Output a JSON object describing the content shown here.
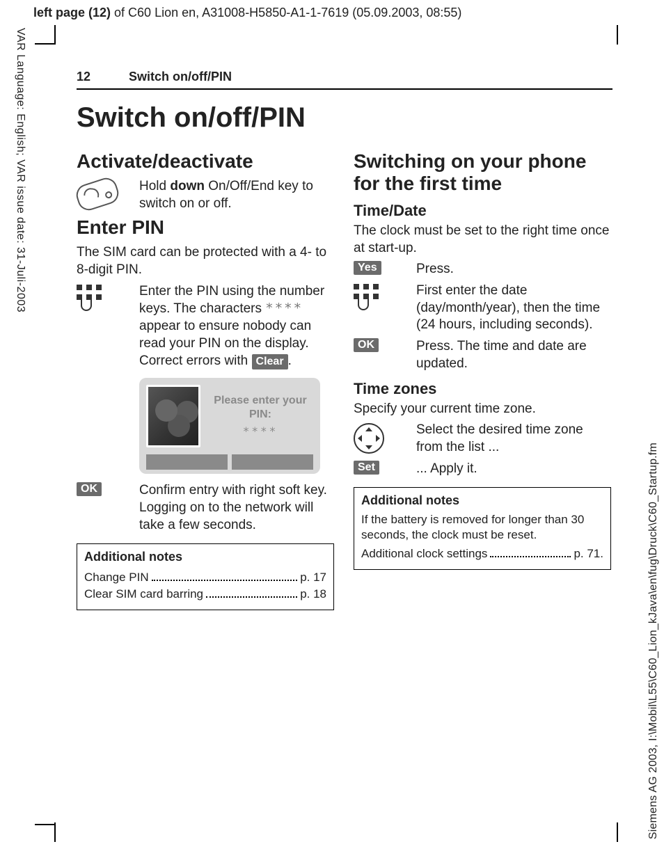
{
  "crop": {
    "top_bold": "left page (12)",
    "top_rest": " of C60 Lion en, A31008-H5850-A1-1-7619 (05.09.2003, 08:55)",
    "side_left": "VAR Language: English; VAR issue date: 31-Juli-2003",
    "side_right": "Siemens AG 2003, I:\\Mobil\\L55\\C60_Lion_kJava\\en\\fug\\Druck\\C60_Startup.fm"
  },
  "header": {
    "page_number": "12",
    "running_title": "Switch on/off/PIN"
  },
  "title": "Switch on/off/PIN",
  "left": {
    "h_activate": "Activate/deactivate",
    "activate_text_pre": "Hold ",
    "activate_text_bold": "down",
    "activate_text_post": " On/Off/End key to switch on or off.",
    "h_enterpin": "Enter PIN",
    "enterpin_intro": "The SIM card can be protected with a 4- to 8-digit PIN.",
    "enterpin_keypad_pre": "Enter the PIN using the number keys. The characters ",
    "enterpin_keypad_stars": "****",
    "enterpin_keypad_mid": " appear to ensure nobody can read your PIN on the display. Correct errors with ",
    "clear_key": "Clear",
    "enterpin_keypad_post": ".",
    "screen_line1": "Please enter your",
    "screen_line2": "PIN:",
    "screen_stars": "****",
    "ok_key": "OK",
    "ok_text": "Confirm entry with right soft key. Logging on to the network will take a few seconds.",
    "notes_title": "Additional notes",
    "notes_rows": [
      {
        "label": "Change PIN",
        "page": "p. 17"
      },
      {
        "label": "Clear SIM card barring",
        "page": "p. 18"
      }
    ]
  },
  "right": {
    "h_first": "Switching on your phone for the first time",
    "h_timedate": "Time/Date",
    "timedate_intro": "The clock must be set to the right time once at start-up.",
    "yes_key": "Yes",
    "yes_text": "Press.",
    "keypad_text": "First enter the date (day/month/year), then the time (24 hours, including seconds).",
    "ok_key": "OK",
    "ok_text": "Press. The time and date are updated.",
    "h_timezones": "Time zones",
    "timezones_intro": "Specify your current time zone.",
    "nav_text": "Select the desired time zone from the list ...",
    "set_key": "Set",
    "set_text": "... Apply it.",
    "notes_title": "Additional notes",
    "notes_body": "If the battery is removed for longer than 30 seconds, the clock must be reset.",
    "notes_row": {
      "label": "Additional clock settings",
      "page": "p. 71."
    }
  }
}
